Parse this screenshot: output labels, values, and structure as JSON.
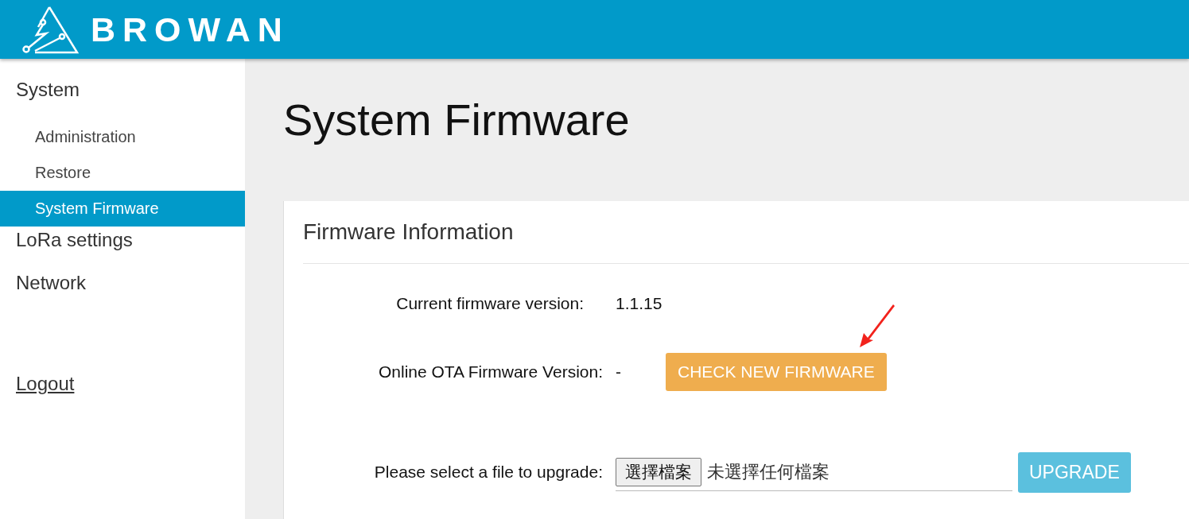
{
  "header": {
    "logo_text": "BROWAN"
  },
  "sidebar": {
    "items": [
      {
        "label": "System",
        "selected": false,
        "children": [
          {
            "label": "Administration",
            "selected": false
          },
          {
            "label": "Restore",
            "selected": false
          },
          {
            "label": "System Firmware",
            "selected": true
          }
        ]
      },
      {
        "label": "LoRa settings",
        "selected": false
      },
      {
        "label": "Network",
        "selected": false
      }
    ],
    "logout": "Logout"
  },
  "page_title": "System Firmware",
  "card": {
    "title": "Firmware Information",
    "rows": [
      {
        "kind": "text",
        "label": "Current firmware version:",
        "value": "1.1.15"
      },
      {
        "kind": "button",
        "label": "Online OTA Firmware Version:",
        "value": "-",
        "button": "CHECK NEW FIRMWARE"
      },
      {
        "kind": "file",
        "label": "Please select a file to upgrade:",
        "file_button": "選擇檔案",
        "file_status": "未選擇任何檔案",
        "button": "UPGRADE"
      }
    ]
  }
}
